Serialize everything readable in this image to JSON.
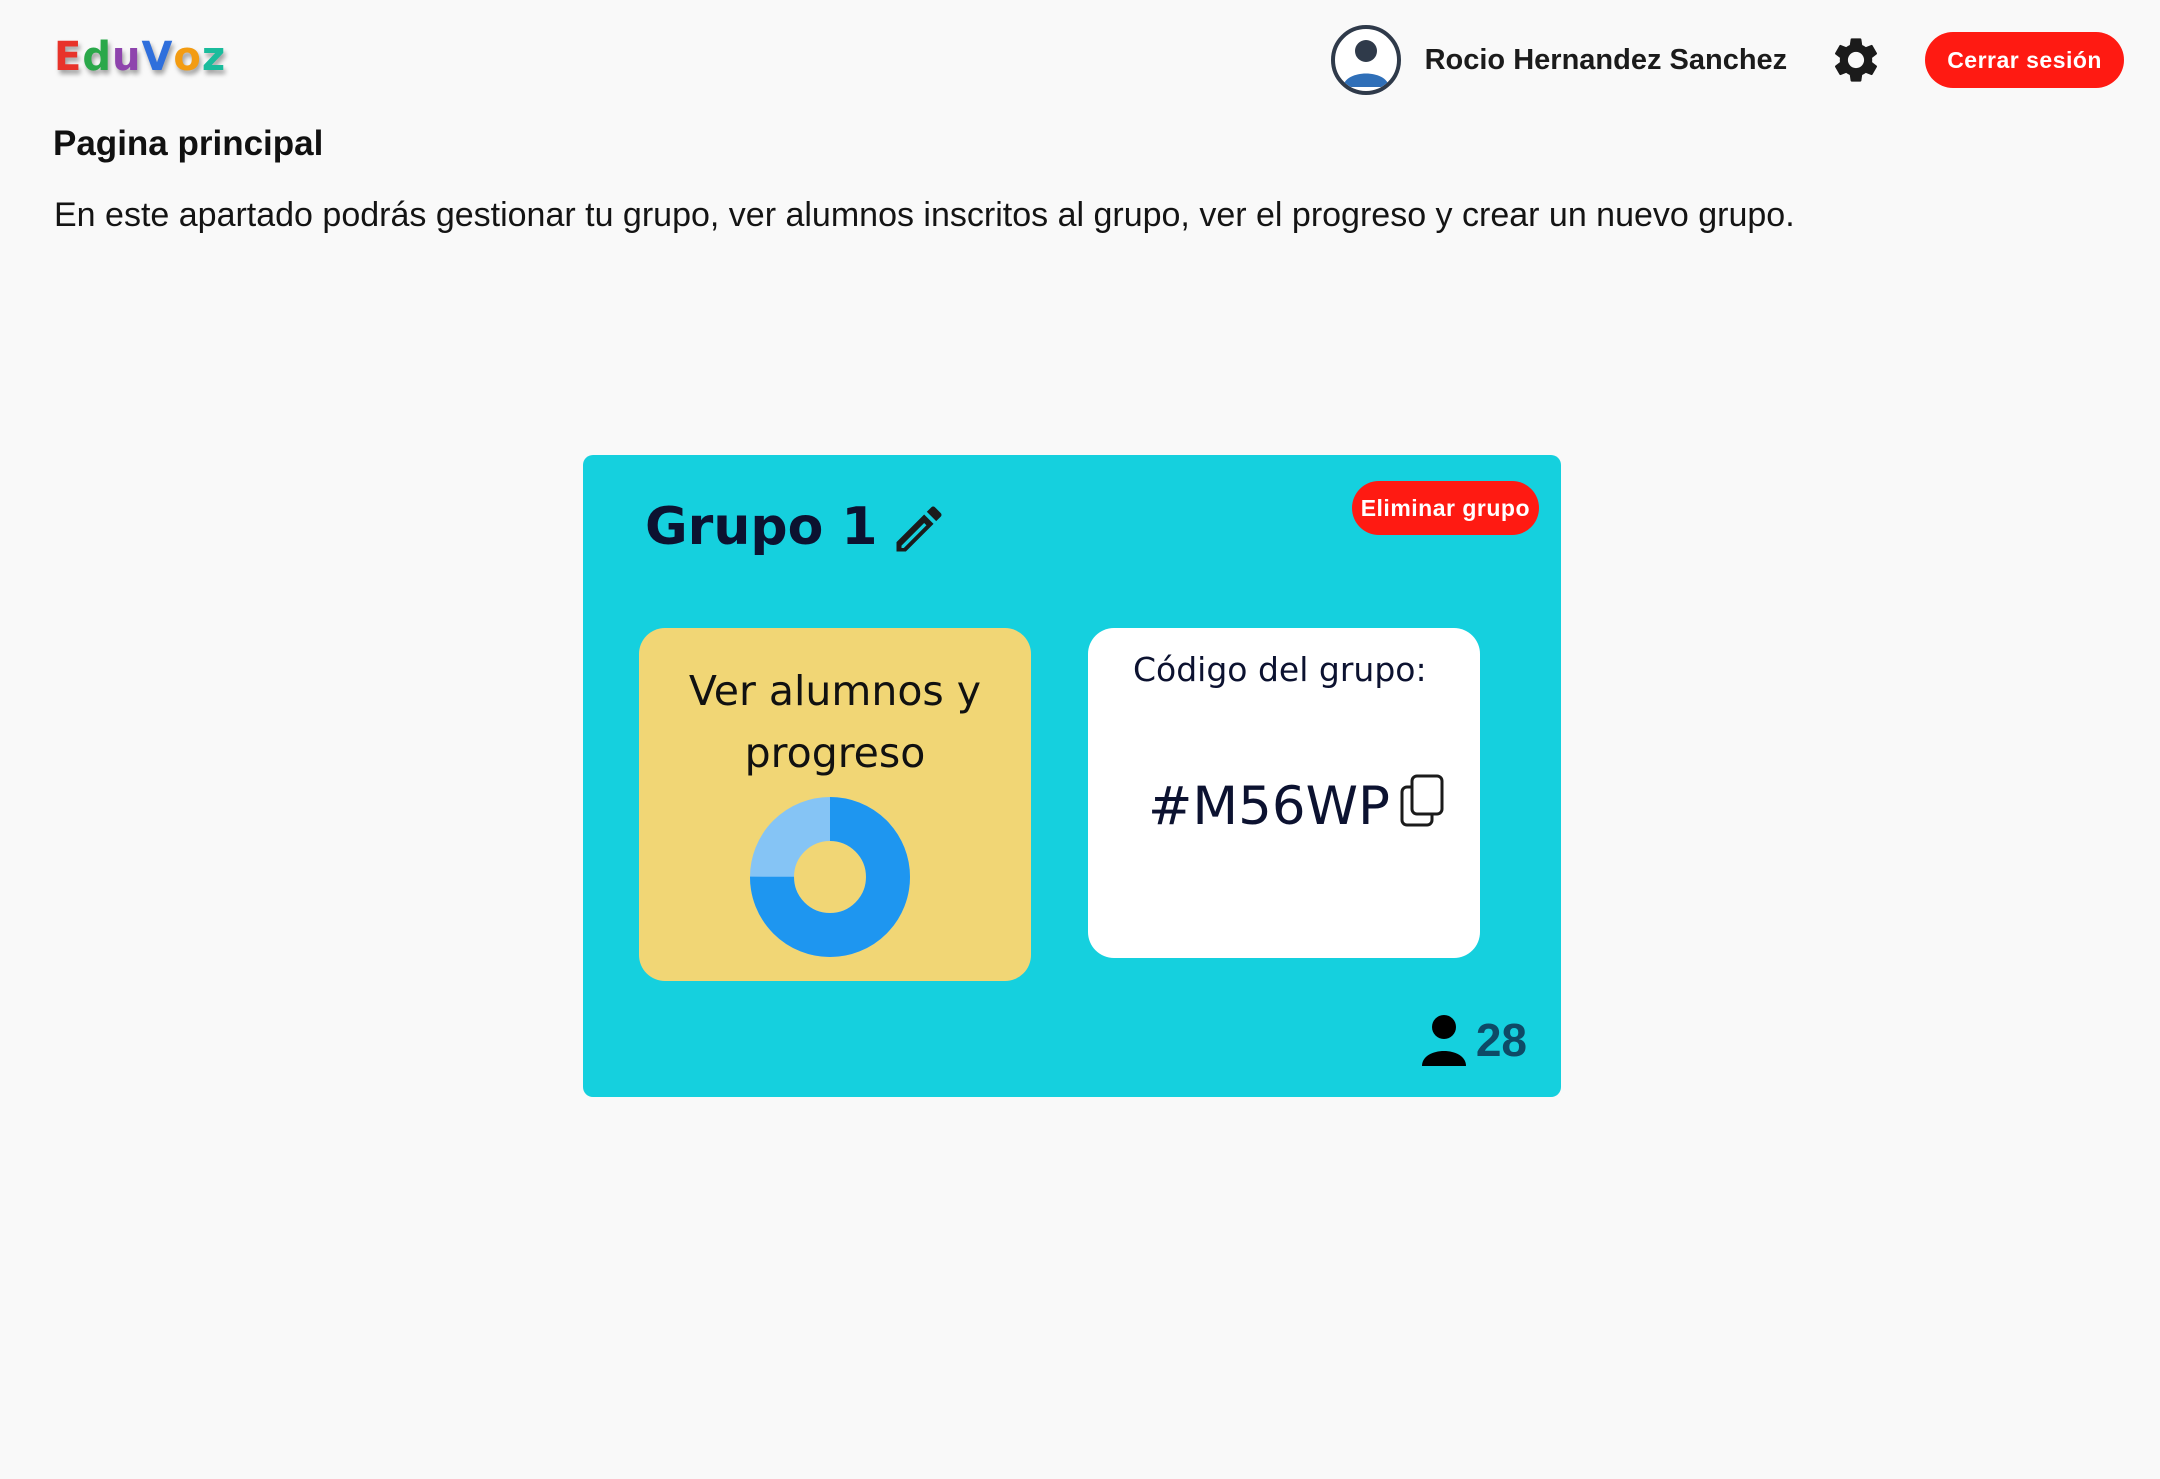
{
  "header": {
    "logo_letters": [
      {
        "char": "E",
        "color": "#e8332a"
      },
      {
        "char": "d",
        "color": "#2aa84a"
      },
      {
        "char": "u",
        "color": "#8e44ad"
      },
      {
        "char": "V",
        "color": "#2f6fdc"
      },
      {
        "char": "o",
        "color": "#f39c12"
      },
      {
        "char": "z",
        "color": "#1abc9c"
      }
    ],
    "user_name": "Rocio Hernandez Sanchez",
    "avatar_icon": "user-avatar-icon",
    "settings_icon": "gear-icon",
    "logout_label": "Cerrar sesión"
  },
  "page": {
    "title": "Pagina principal",
    "description": "En este apartado podrás gestionar tu grupo, ver alumnos inscritos al grupo, ver el progreso y crear un nuevo grupo."
  },
  "group": {
    "name": "Grupo 1",
    "edit_icon": "pencil-icon",
    "delete_label": "Eliminar grupo",
    "progress_label_line1": "Ver alumnos y",
    "progress_label_line2": "progreso",
    "progress_fraction": 0.75,
    "code_label": "Código del grupo:",
    "code_value": "#M56WP",
    "copy_icon": "copy-icon",
    "members_icon": "person-icon",
    "members_count": "28"
  },
  "colors": {
    "accent_red": "#ff1a12",
    "card_bg": "#15d0de",
    "progress_tile_bg": "#f1d675",
    "donut_primary": "#1e96f0",
    "donut_secondary": "#85c4f5"
  }
}
